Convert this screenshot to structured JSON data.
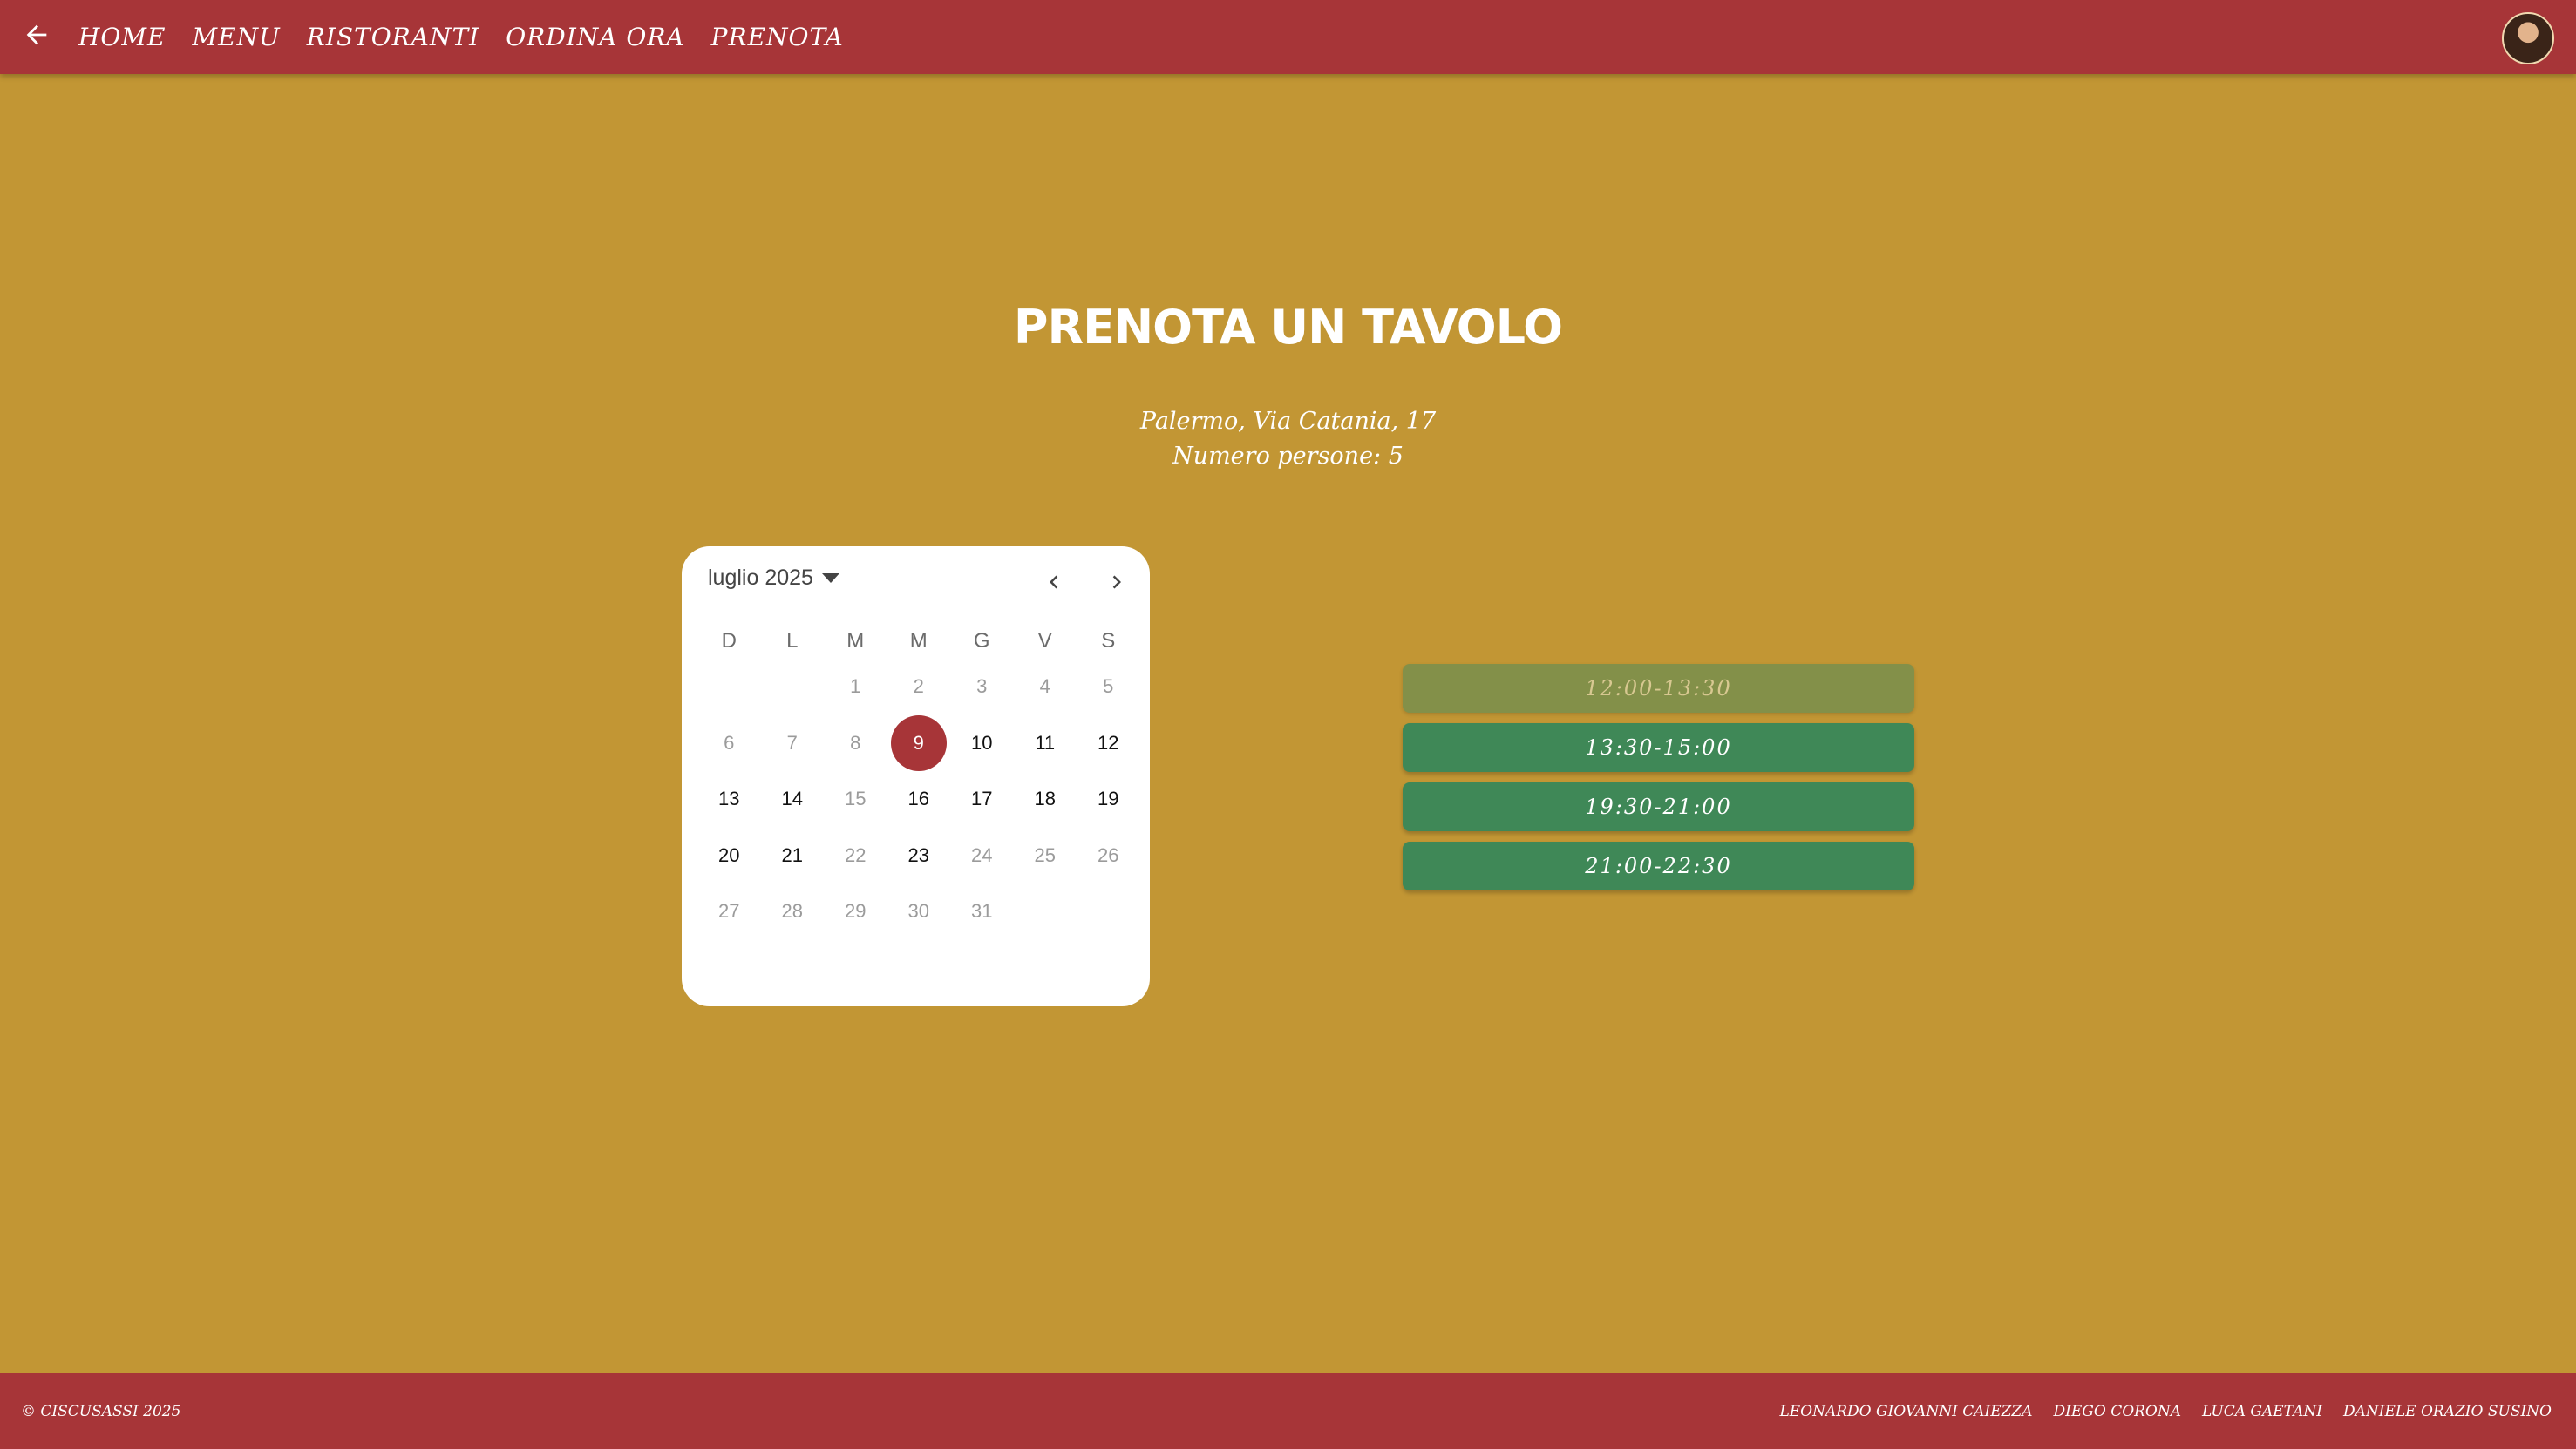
{
  "nav": {
    "back_icon": "arrow-left-icon",
    "items": [
      "HOME",
      "MENU",
      "RISTORANTI",
      "ORDINA ORA",
      "PRENOTA"
    ],
    "avatar_icon": "user-avatar"
  },
  "page": {
    "title": "PRENOTA UN TAVOLO",
    "address": "Palermo, Via Catania, 17",
    "people": "Numero persone: 5"
  },
  "calendar": {
    "month_label": "luglio 2025",
    "weekdays": [
      "D",
      "L",
      "M",
      "M",
      "G",
      "V",
      "S"
    ],
    "selected_day": "9",
    "weeks": [
      [
        {
          "d": ""
        },
        {
          "d": ""
        },
        {
          "d": "1",
          "dim": true
        },
        {
          "d": "2",
          "dim": true
        },
        {
          "d": "3",
          "dim": true
        },
        {
          "d": "4",
          "dim": true
        },
        {
          "d": "5",
          "dim": true
        }
      ],
      [
        {
          "d": "6",
          "dim": true
        },
        {
          "d": "7",
          "dim": true
        },
        {
          "d": "8",
          "dim": true
        },
        {
          "d": "9",
          "selected": true
        },
        {
          "d": "10"
        },
        {
          "d": "11"
        },
        {
          "d": "12"
        }
      ],
      [
        {
          "d": "13"
        },
        {
          "d": "14"
        },
        {
          "d": "15",
          "dim": true
        },
        {
          "d": "16"
        },
        {
          "d": "17"
        },
        {
          "d": "18"
        },
        {
          "d": "19"
        }
      ],
      [
        {
          "d": "20"
        },
        {
          "d": "21"
        },
        {
          "d": "22",
          "dim": true
        },
        {
          "d": "23"
        },
        {
          "d": "24",
          "dim": true
        },
        {
          "d": "25",
          "dim": true
        },
        {
          "d": "26",
          "dim": true
        }
      ],
      [
        {
          "d": "27",
          "dim": true
        },
        {
          "d": "28",
          "dim": true
        },
        {
          "d": "29",
          "dim": true
        },
        {
          "d": "30",
          "dim": true
        },
        {
          "d": "31",
          "dim": true
        },
        {
          "d": ""
        },
        {
          "d": ""
        }
      ]
    ]
  },
  "slots": [
    {
      "label": "12:00-13:30",
      "available": false
    },
    {
      "label": "13:30-15:00",
      "available": true
    },
    {
      "label": "19:30-21:00",
      "available": true
    },
    {
      "label": "21:00-22:30",
      "available": true
    }
  ],
  "footer": {
    "copyright": "© CISCUSASSI 2025",
    "authors": [
      "LEONARDO GIOVANNI CAIEZZA",
      "DIEGO CORONA",
      "LUCA GAETANI",
      "DANIELE ORAZIO SUSINO"
    ]
  },
  "colors": {
    "background": "#c29634",
    "primary": "#a73538",
    "slot_available": "#3f8857",
    "slot_unavailable": "#839049"
  }
}
